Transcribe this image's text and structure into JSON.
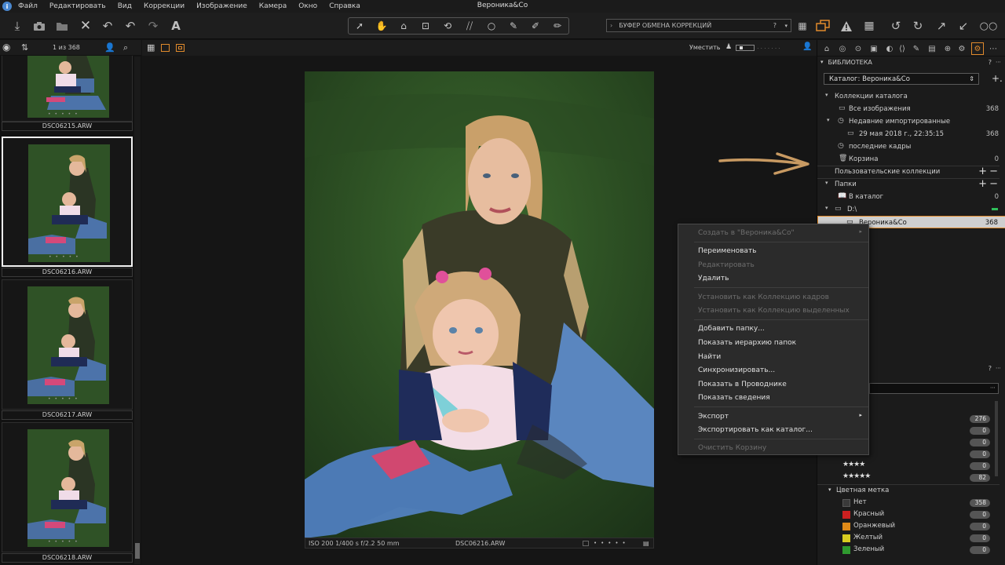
{
  "app": {
    "title": "Вероника&Co",
    "logo": "info-logo-icon"
  },
  "menu": [
    "Файл",
    "Редактировать",
    "Вид",
    "Коррекции",
    "Изображение",
    "Камера",
    "Окно",
    "Справка"
  ],
  "toolbar": {
    "left_icons": [
      "import-icon",
      "camera-icon",
      "folder-icon",
      "delete-icon",
      "undo-icon",
      "undo-all-icon",
      "redo-icon",
      "text-icon"
    ],
    "tools": [
      "cursor-tool-icon",
      "pan-tool-icon",
      "loupe-tool-icon",
      "crop-tool-icon",
      "rotate-tool-icon",
      "keystone-tool-icon",
      "spot-tool-icon",
      "brush-tool-icon",
      "eraser-tool-icon",
      "annotation-tool-icon"
    ],
    "clipboard_label": "БУФЕР ОБМЕНА КОРРЕКЦИЙ",
    "clipboard_help": "?",
    "right_icons": [
      "grid-view-icon",
      "multi-view-icon",
      "exposure-warning-icon",
      "focus-mask-icon",
      "rotate-left-icon",
      "rotate-right-icon",
      "copy-adjust-icon",
      "apply-adjust-icon",
      "proof-icon"
    ]
  },
  "browser": {
    "counter": "1 из 368",
    "thumbnails": [
      {
        "name": "DSC06215.ARW",
        "selected": false
      },
      {
        "name": "DSC06216.ARW",
        "selected": true
      },
      {
        "name": "DSC06217.ARW",
        "selected": false
      },
      {
        "name": "DSC06218.ARW",
        "selected": false
      }
    ]
  },
  "viewer": {
    "zoom_label": "Уместить",
    "caption_exif": "ISO 200  1/400 s  f/2.2  50 mm",
    "caption_file": "DSC06216.ARW"
  },
  "context_menu": {
    "items": [
      {
        "label": "Создать в \"Вероника&Co\"",
        "disabled": true,
        "submenu": true
      },
      {
        "label": "Переименовать",
        "disabled": false
      },
      {
        "label": "Редактировать",
        "disabled": true
      },
      {
        "label": "Удалить",
        "disabled": false
      },
      {
        "label": "Установить как Коллекцию кадров",
        "disabled": true
      },
      {
        "label": "Установить как Коллекцию выделенных",
        "disabled": true
      },
      {
        "label": "Добавить папку...",
        "disabled": false
      },
      {
        "label": "Показать иерархию папок",
        "disabled": false
      },
      {
        "label": "Найти",
        "disabled": false
      },
      {
        "label": "Синхронизировать...",
        "disabled": false
      },
      {
        "label": "Показать в Проводнике",
        "disabled": false
      },
      {
        "label": "Показать сведения",
        "disabled": false
      },
      {
        "label": "Экспорт",
        "disabled": false,
        "submenu": true
      },
      {
        "label": "Экспортировать как каталог...",
        "disabled": false
      },
      {
        "label": "Очистить Корзину",
        "disabled": true
      }
    ]
  },
  "library": {
    "header": "БИБЛИОТЕКА",
    "help": "?",
    "catalog_label": "Каталог: Вероника&Co",
    "collections_header": "Коллекции каталога",
    "all_images": {
      "label": "Все изображения",
      "count": "368"
    },
    "recent_imports": {
      "label": "Недавние импортированные"
    },
    "import_date": {
      "label": "29 мая 2018 г., 22:35:15",
      "count": "368"
    },
    "last_shots": {
      "label": "последние кадры"
    },
    "trash": {
      "label": "Корзина",
      "count": "0"
    },
    "user_collections": "Пользовательские коллекции",
    "folders_header": "Папки",
    "in_catalog": {
      "label": "В каталог",
      "count": "0"
    },
    "drive": {
      "label": "D:\\"
    },
    "folder": {
      "label": "Вероника&Co",
      "count": "368"
    }
  },
  "filters": {
    "help": "?",
    "rating_counts": [
      "276",
      "0",
      "0",
      "0",
      "0",
      "82"
    ],
    "color_header": "Цветная метка",
    "colors": [
      {
        "label": "Нет",
        "count": "358",
        "color": "#3a3a3a"
      },
      {
        "label": "Красный",
        "count": "0",
        "color": "#cc2020"
      },
      {
        "label": "Оранжевый",
        "count": "0",
        "color": "#e08a18"
      },
      {
        "label": "Желтый",
        "count": "0",
        "color": "#d8cc20"
      },
      {
        "label": "Зеленый",
        "count": "0",
        "color": "#2f9a2f"
      }
    ]
  },
  "colors": {
    "accent": "#e08a2c",
    "arrow": "#c89a62"
  }
}
